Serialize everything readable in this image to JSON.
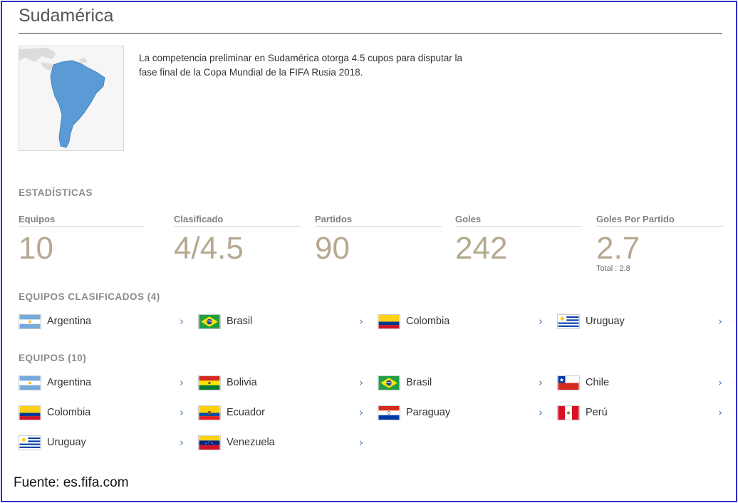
{
  "title": "Sudamérica",
  "description": "La competencia preliminar en Sudamérica otorga 4.5 cupos para disputar la fase final de la Copa Mundial de la FIFA Rusia 2018.",
  "stats_title": "ESTADÍSTICAS",
  "stats": [
    {
      "label": "Equipos",
      "value": "10"
    },
    {
      "label": "Clasificado",
      "value": "4/4.5"
    },
    {
      "label": "Partidos",
      "value": "90"
    },
    {
      "label": "Goles",
      "value": "242"
    },
    {
      "label": "Goles Por Partido",
      "value": "2.7",
      "sub": "Total : 2.8"
    }
  ],
  "qualified_title": "EQUIPOS CLASIFICADOS (4)",
  "qualified": [
    {
      "name": "Argentina",
      "flag": "argentina"
    },
    {
      "name": "Brasil",
      "flag": "brasil"
    },
    {
      "name": "Colombia",
      "flag": "colombia"
    },
    {
      "name": "Uruguay",
      "flag": "uruguay"
    }
  ],
  "teams_title": "EQUIPOS (10)",
  "teams": [
    {
      "name": "Argentina",
      "flag": "argentina"
    },
    {
      "name": "Bolivia",
      "flag": "bolivia"
    },
    {
      "name": "Brasil",
      "flag": "brasil"
    },
    {
      "name": "Chile",
      "flag": "chile"
    },
    {
      "name": "Colombia",
      "flag": "colombia"
    },
    {
      "name": "Ecuador",
      "flag": "ecuador"
    },
    {
      "name": "Paraguay",
      "flag": "paraguay"
    },
    {
      "name": "Perú",
      "flag": "peru"
    },
    {
      "name": "Uruguay",
      "flag": "uruguay"
    },
    {
      "name": "Venezuela",
      "flag": "venezuela"
    }
  ],
  "chevron": "›",
  "source": "Fuente: es.fifa.com",
  "colors": {
    "accent": "#b5a98f",
    "link": "#4a7fb8",
    "frame": "#3030c8",
    "map": "#5b9bd5"
  }
}
